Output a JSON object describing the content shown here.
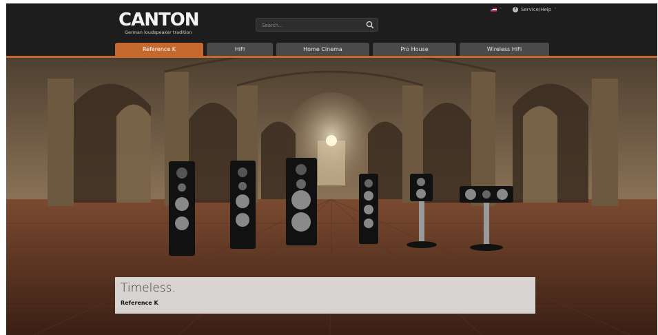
{
  "header": {
    "logo_text": "CANTON",
    "logo_tagline": "German loudspeaker tradition",
    "search_placeholder": "Search...",
    "service_help_label": "Service/Help"
  },
  "nav": {
    "tabs": [
      {
        "label": "Reference K",
        "active": true
      },
      {
        "label": "HiFi",
        "active": false
      },
      {
        "label": "Home Cinema",
        "active": false
      },
      {
        "label": "Pro House",
        "active": false
      },
      {
        "label": "Wireless HiFi",
        "active": false
      }
    ]
  },
  "hero": {
    "title": "Timeless.",
    "subtitle": "Reference K"
  },
  "colors": {
    "accent": "#c46a2e",
    "header_bg": "#1d1d1d",
    "tab_bg": "#4a4a4a"
  }
}
